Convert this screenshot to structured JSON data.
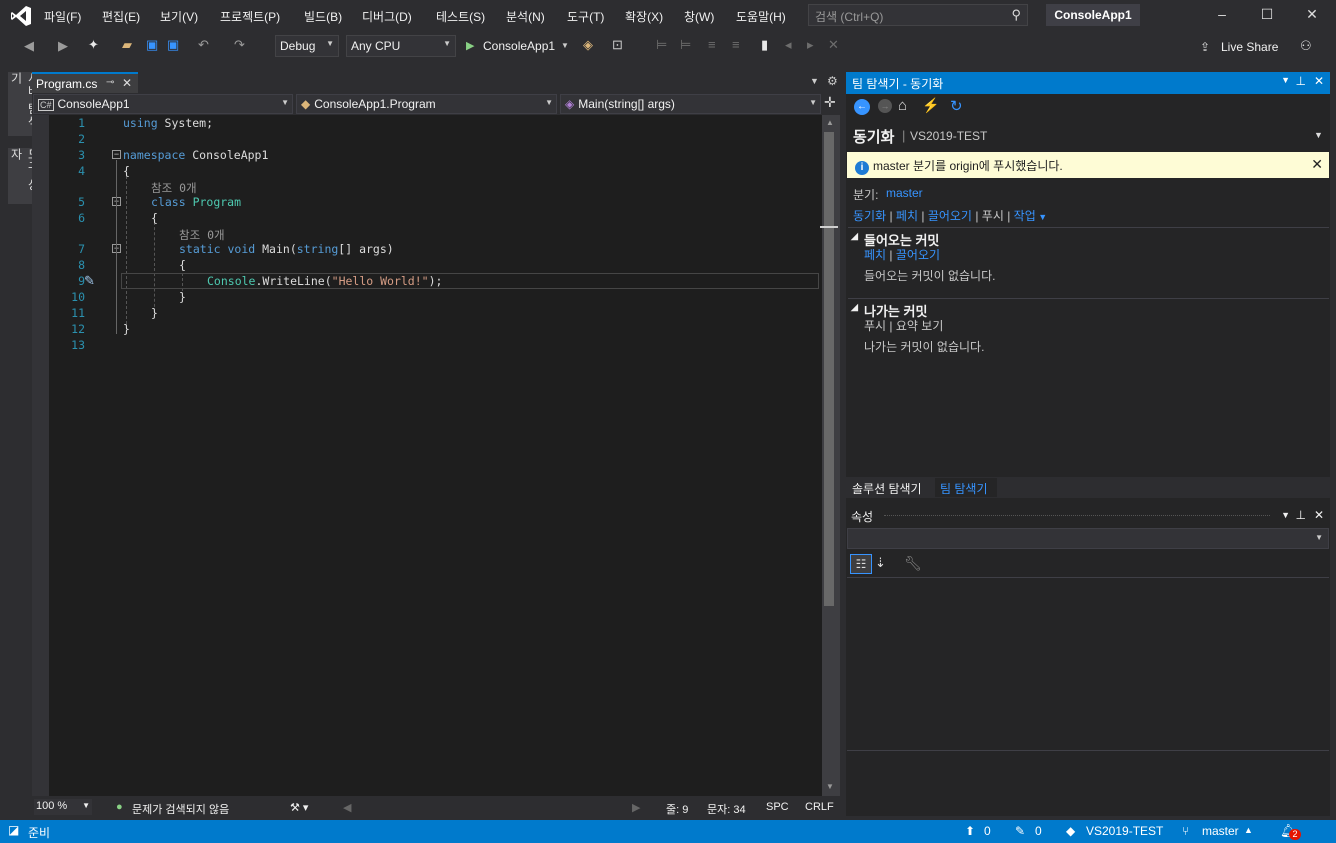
{
  "menu": [
    "파일(F)",
    "편집(E)",
    "보기(V)",
    "프로젝트(P)",
    "빌드(B)",
    "디버그(D)",
    "테스트(S)",
    "분석(N)",
    "도구(T)",
    "확장(X)",
    "창(W)",
    "도움말(H)"
  ],
  "search": {
    "placeholder": "검색 (Ctrl+Q)"
  },
  "app_title": "ConsoleApp1",
  "toolbar": {
    "config": "Debug",
    "platform": "Any CPU",
    "run_label": "ConsoleApp1",
    "live_share": "Live Share"
  },
  "left_tabs": [
    "서버 탐색기",
    "도구 상자"
  ],
  "doc_tab": "Program.cs",
  "nav": {
    "project": "ConsoleApp1",
    "type": "ConsoleApp1.Program",
    "member": "Main(string[] args)"
  },
  "code": {
    "l1_kw": "using",
    "l1_rest": " System;",
    "l3_kw": "namespace",
    "l3_rest": " ConsoleApp1",
    "ob": "{",
    "cb": "}",
    "refs": "참조 0개",
    "l5_kw": "class",
    "l5_ty": "Program",
    "l7_kw1": "static",
    "l7_kw2": "void",
    "l7_name": "Main(",
    "l7_kw3": "string",
    "l7_rest": "[] args)",
    "l9_ty": "Console",
    "l9_mid": ".WriteLine(",
    "l9_str": "\"Hello World!\"",
    "l9_end": ");"
  },
  "line_numbers": [
    "1",
    "2",
    "3",
    "4",
    "5",
    "6",
    "7",
    "8",
    "9",
    "10",
    "11",
    "12",
    "13"
  ],
  "editor_status": {
    "zoom": "100 %",
    "issues": "문제가 검색되지 않음",
    "line": "줄: 9",
    "col": "문자: 34",
    "spc": "SPC",
    "crlf": "CRLF"
  },
  "team": {
    "header": "팀 탐색기 - 동기화",
    "title": "동기화",
    "repo": "VS2019-TEST",
    "info": "master 분기를 origin에 푸시했습니다.",
    "branch_label": "분기:",
    "branch": "master",
    "actions": [
      "동기화",
      "페치",
      "끌어오기",
      "푸시",
      "작업"
    ],
    "incoming_title": "들어오는 커밋",
    "incoming_links": [
      "페치",
      "끌어오기"
    ],
    "incoming_empty": "들어오는 커밋이 없습니다.",
    "outgoing_title": "나가는 커밋",
    "outgoing_links": [
      "푸시",
      "요약 보기"
    ],
    "outgoing_empty": "나가는 커밋이 없습니다."
  },
  "bottom_tabs": [
    "솔루션 탐색기",
    "팀 탐색기"
  ],
  "properties": {
    "title": "속성"
  },
  "status": {
    "ready": "준비",
    "up": "0",
    "edits": "0",
    "repo": "VS2019-TEST",
    "branch": "master",
    "notifications": "2"
  },
  "colors": {
    "accent": "#007acc",
    "background": "#2d2d30",
    "editor": "#1e1e1e"
  }
}
